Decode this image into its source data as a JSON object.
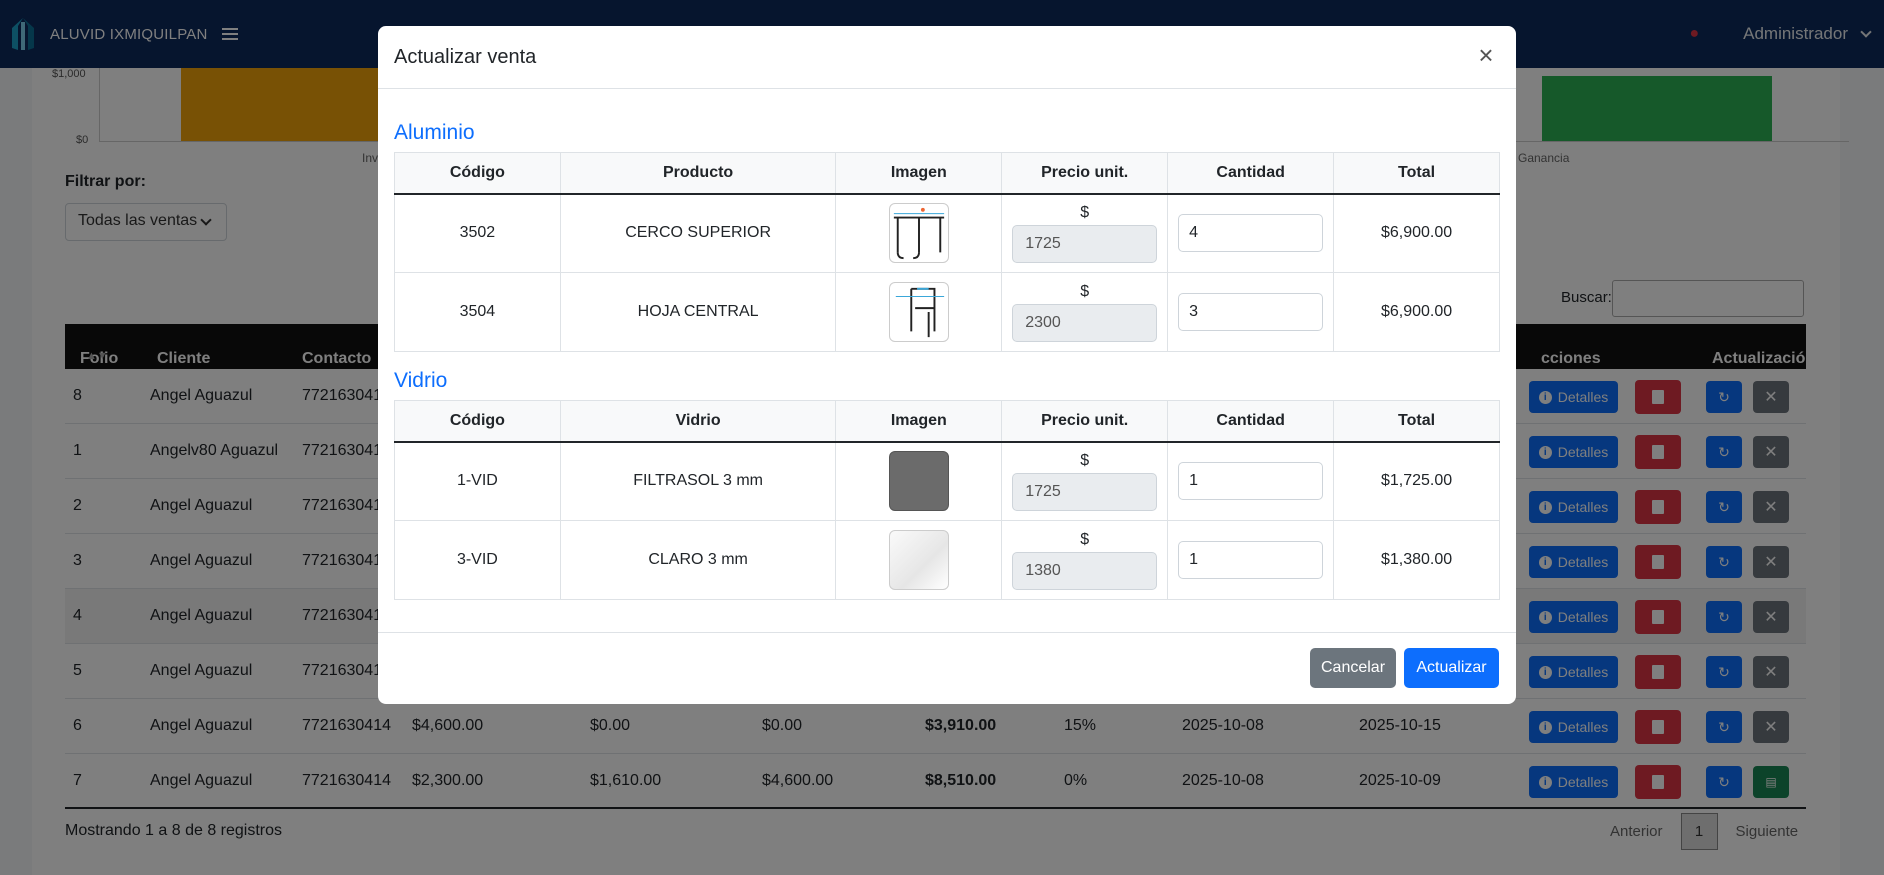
{
  "navbar": {
    "brand": "ALUVID IXMIQUILPAN",
    "user": "Administrador"
  },
  "chart_data": {
    "type": "bar",
    "title": "",
    "y_ticks": [
      "$1,000",
      "$0"
    ],
    "partial_x_labels": [
      "Inv",
      "Ganancia"
    ],
    "bar_colors": [
      "#f0a30a",
      "#2db355"
    ]
  },
  "filter": {
    "label": "Filtrar por:",
    "selected": "Todas las ventas"
  },
  "search": {
    "label": "Buscar:"
  },
  "table": {
    "headers": {
      "folio": "Folio",
      "cliente": "Cliente",
      "contacto": "Contacto",
      "acciones": "cciones",
      "actualizacion": "Actualización"
    },
    "rows": [
      {
        "folio": "8",
        "cliente": "Angel Aguazul",
        "contacto": "772163041"
      },
      {
        "folio": "1",
        "cliente": "Angelv80 Aguazul",
        "contacto": "772163041"
      },
      {
        "folio": "2",
        "cliente": "Angel Aguazul",
        "contacto": "772163041"
      },
      {
        "folio": "3",
        "cliente": "Angel Aguazul",
        "contacto": "772163041"
      },
      {
        "folio": "4",
        "cliente": "Angel Aguazul",
        "contacto": "772163041"
      },
      {
        "folio": "5",
        "cliente": "Angel Aguazul",
        "contacto": "772163041"
      },
      {
        "folio": "6",
        "cliente": "Angel Aguazul",
        "contacto": "7721630414",
        "c1": "$4,600.00",
        "c2": "$0.00",
        "c3": "$0.00",
        "total": "$3,910.00",
        "desc": "15%",
        "fecha1": "2025-10-08",
        "fecha2": "2025-10-15"
      },
      {
        "folio": "7",
        "cliente": "Angel Aguazul",
        "contacto": "7721630414",
        "c1": "$2,300.00",
        "c2": "$1,610.00",
        "c3": "$4,600.00",
        "total": "$8,510.00",
        "desc": "0%",
        "fecha1": "2025-10-08",
        "fecha2": "2025-10-09"
      }
    ],
    "details_label": "Detalles"
  },
  "footer": {
    "info": "Mostrando 1 a 8 de 8 registros",
    "prev": "Anterior",
    "page": "1",
    "next": "Siguiente"
  },
  "modal": {
    "title": "Actualizar venta",
    "aluminio": {
      "title": "Aluminio",
      "headers": [
        "Código",
        "Producto",
        "Imagen",
        "Precio unit.",
        "Cantidad",
        "Total"
      ],
      "rows": [
        {
          "codigo": "3502",
          "producto": "CERCO SUPERIOR",
          "currency": "$",
          "precio": "1725",
          "cantidad": "4",
          "total": "$6,900.00"
        },
        {
          "codigo": "3504",
          "producto": "HOJA CENTRAL",
          "currency": "$",
          "precio": "2300",
          "cantidad": "3",
          "total": "$6,900.00"
        }
      ]
    },
    "vidrio": {
      "title": "Vidrio",
      "headers": [
        "Código",
        "Vidrio",
        "Imagen",
        "Precio unit.",
        "Cantidad",
        "Total"
      ],
      "rows": [
        {
          "codigo": "1-VID",
          "producto": "FILTRASOL 3 mm",
          "currency": "$",
          "precio": "1725",
          "cantidad": "1",
          "total": "$1,725.00"
        },
        {
          "codigo": "3-VID",
          "producto": "CLARO 3 mm",
          "currency": "$",
          "precio": "1380",
          "cantidad": "1",
          "total": "$1,380.00"
        }
      ]
    },
    "cancel_label": "Cancelar",
    "update_label": "Actualizar"
  }
}
